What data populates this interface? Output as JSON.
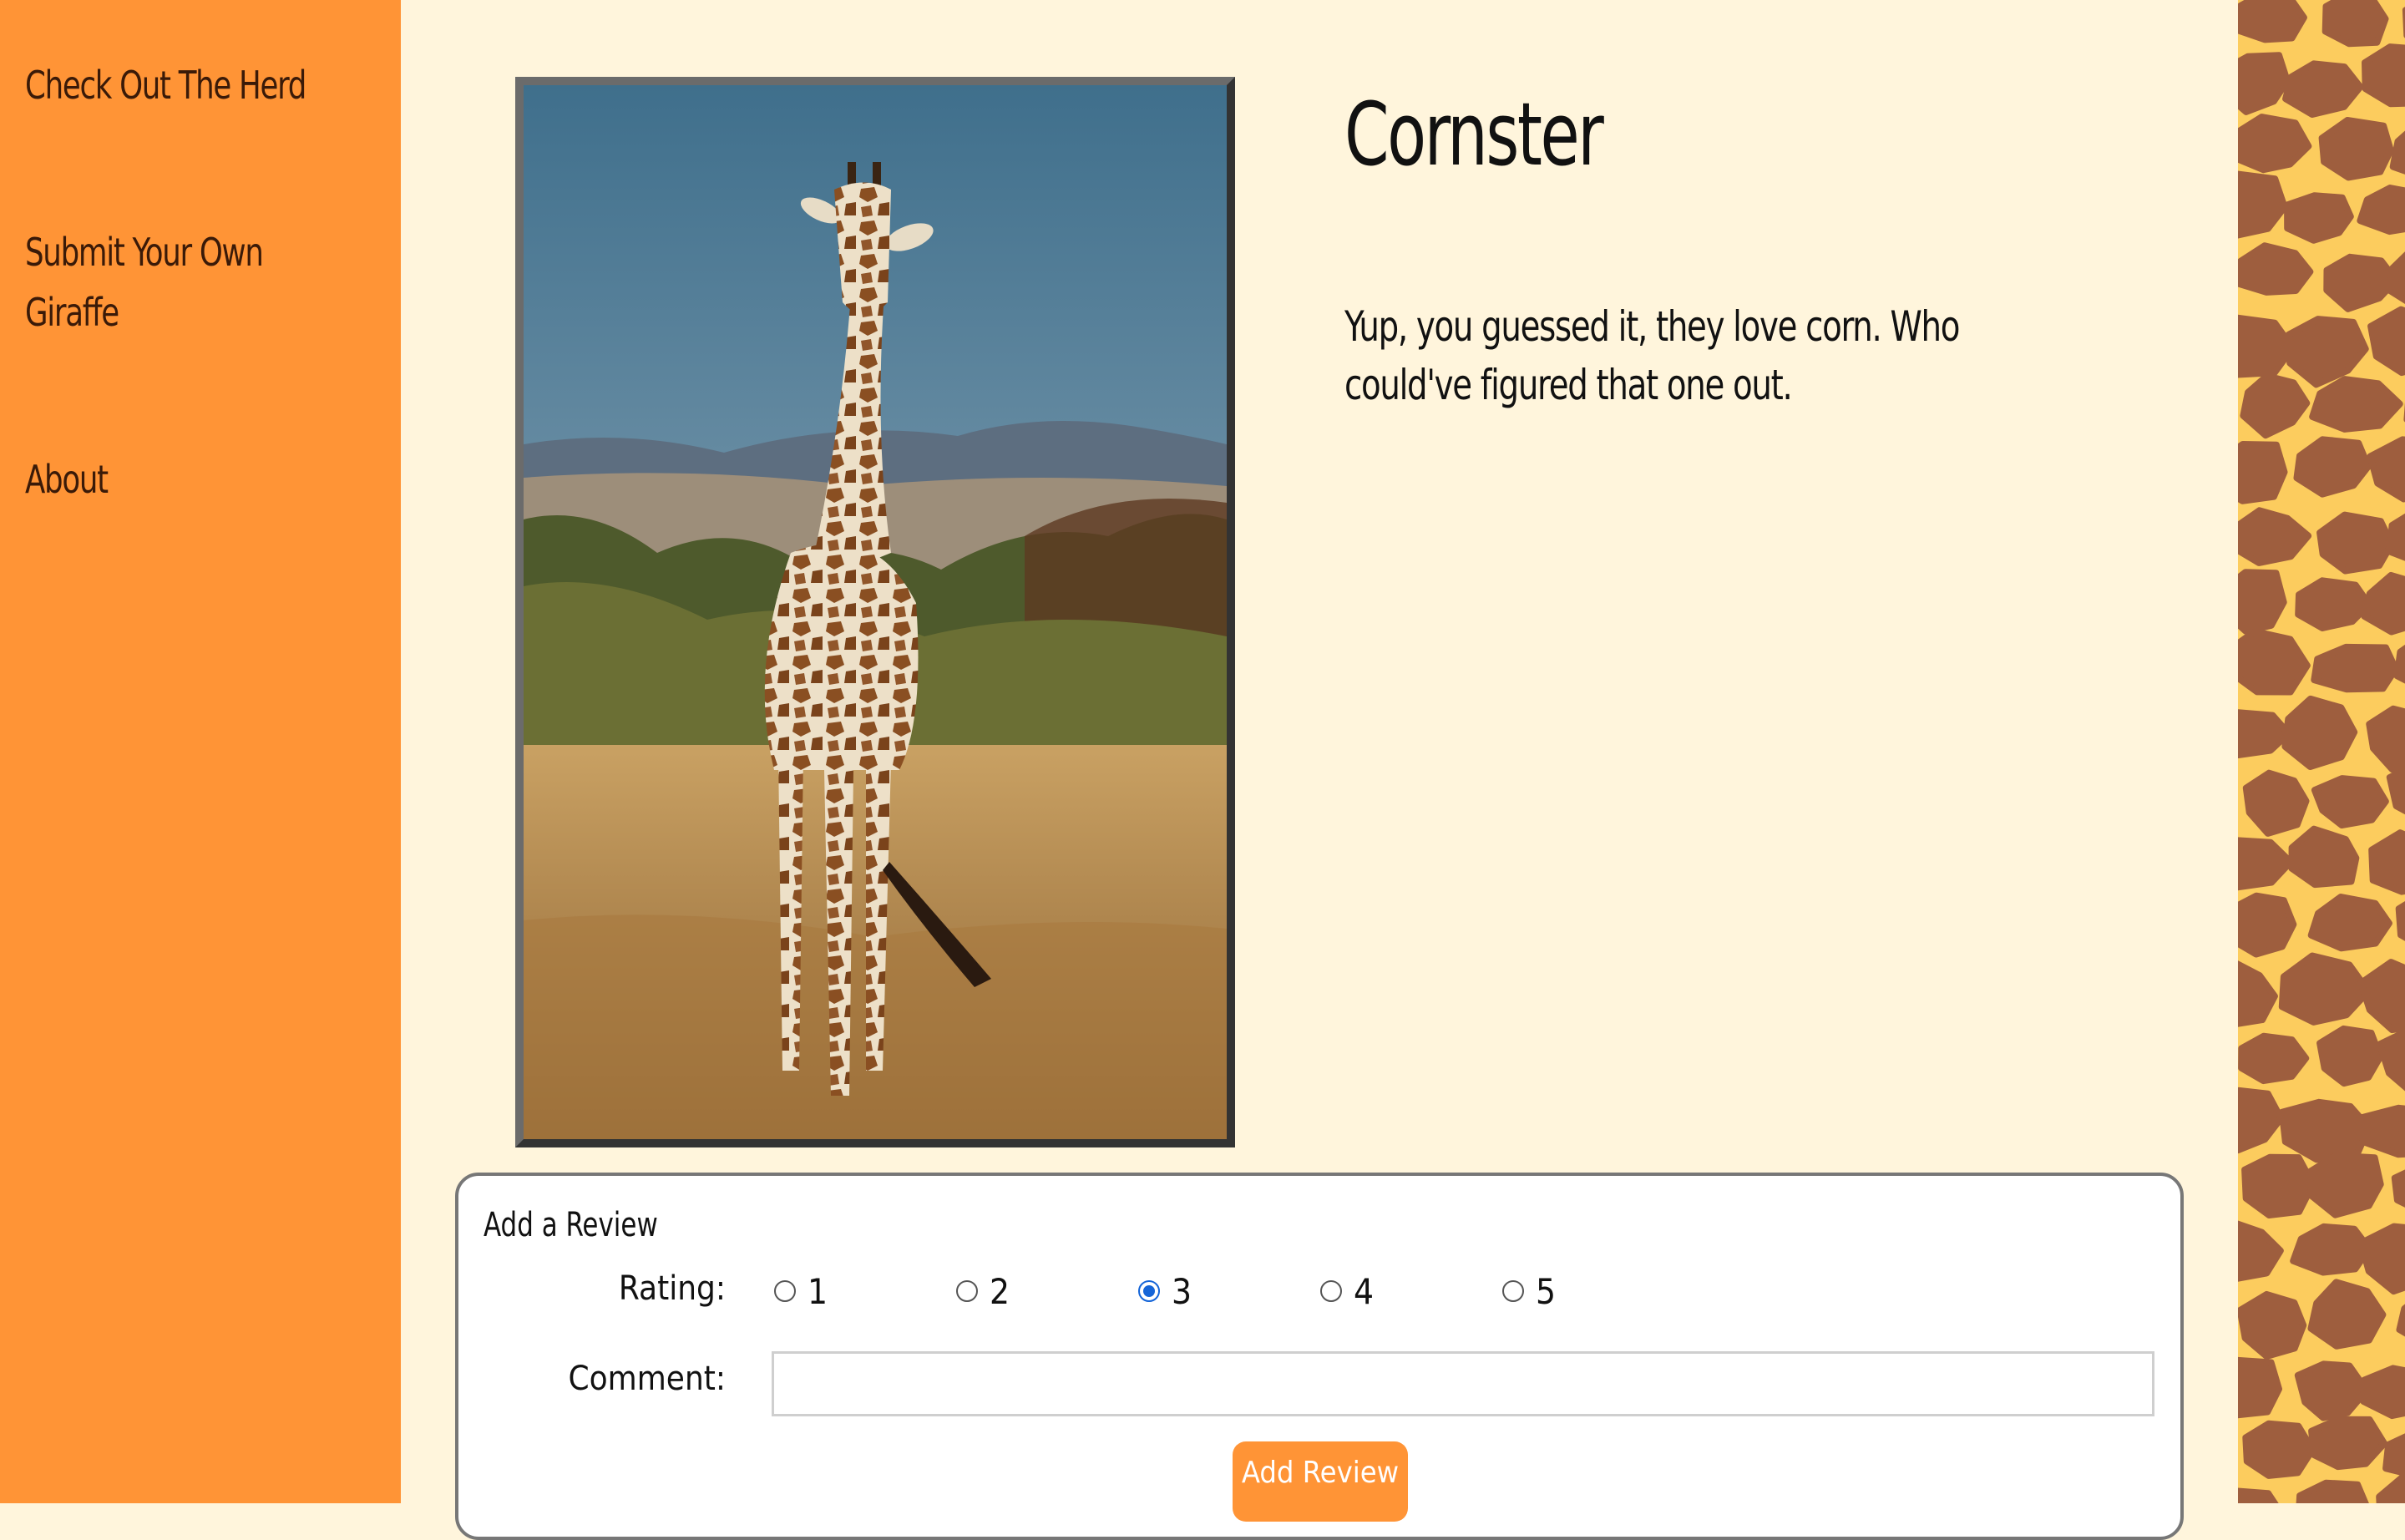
{
  "sidebar": {
    "links": [
      "Check Out The Herd",
      "Submit Your Own Giraffe",
      "About"
    ]
  },
  "giraffe": {
    "name": "Cornster",
    "description": "Yup, you guessed it, they love corn. Who could've figured that one out."
  },
  "review": {
    "title": "Add a Review",
    "rating_label": "Rating:",
    "options": [
      "1",
      "2",
      "3",
      "4",
      "5"
    ],
    "selected": "3",
    "comment_label": "Comment:",
    "comment_value": "",
    "submit_label": "Add Review"
  },
  "colors": {
    "sidebar": "#FF9436",
    "page_background": "#FFF5DC",
    "pattern_background": "#FCCC5E",
    "pattern_spots": "#9E5E3E",
    "accent_button": "#FF9436",
    "radio_selected": "#1565D8"
  }
}
